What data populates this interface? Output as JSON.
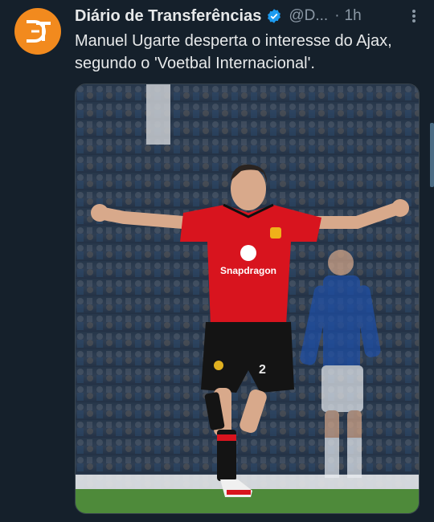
{
  "tweet": {
    "display_name": "Diário de Transferências",
    "handle": "@D...",
    "separator": "·",
    "time": "1h",
    "text": "Manuel Ugarte desperta o interesse do Ajax, segundo o 'Voetbal Internacional'.",
    "avatar_icon": "dt-logo-icon",
    "verified_icon": "verified-badge-icon",
    "more_icon": "more-vertical-icon"
  },
  "media": {
    "shirt_sponsor": "Snapdragon",
    "shirt_number": "2"
  },
  "colors": {
    "background": "#15202b",
    "avatar": "#f28a1e",
    "verified": "#1d9bf0",
    "united_red": "#d8141e",
    "everton_blue": "#1e4fa8",
    "pitch": "#4e8a3a"
  }
}
